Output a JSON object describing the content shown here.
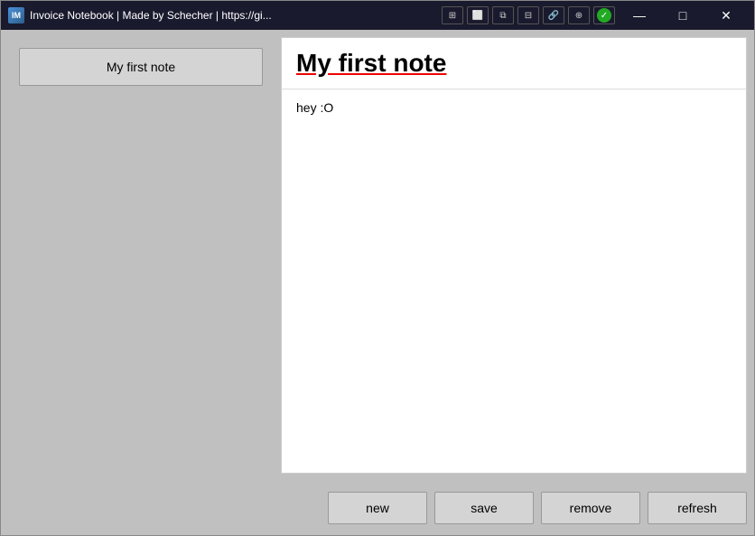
{
  "titlebar": {
    "app_icon_label": "IM",
    "title": "Invoice Notebook | Made by Schecher | https://gi...",
    "tools": [
      "⊞",
      "⬜",
      "⧉",
      "⊟",
      "🔗",
      "⊕",
      "✓"
    ],
    "minimize_label": "—",
    "maximize_label": "□",
    "close_label": "✕"
  },
  "sidebar": {
    "notes": [
      {
        "label": "My first note"
      }
    ]
  },
  "editor": {
    "note_title": "My first note",
    "note_content": "hey :O"
  },
  "actions": {
    "new_label": "new",
    "save_label": "save",
    "remove_label": "remove",
    "refresh_label": "refresh"
  }
}
